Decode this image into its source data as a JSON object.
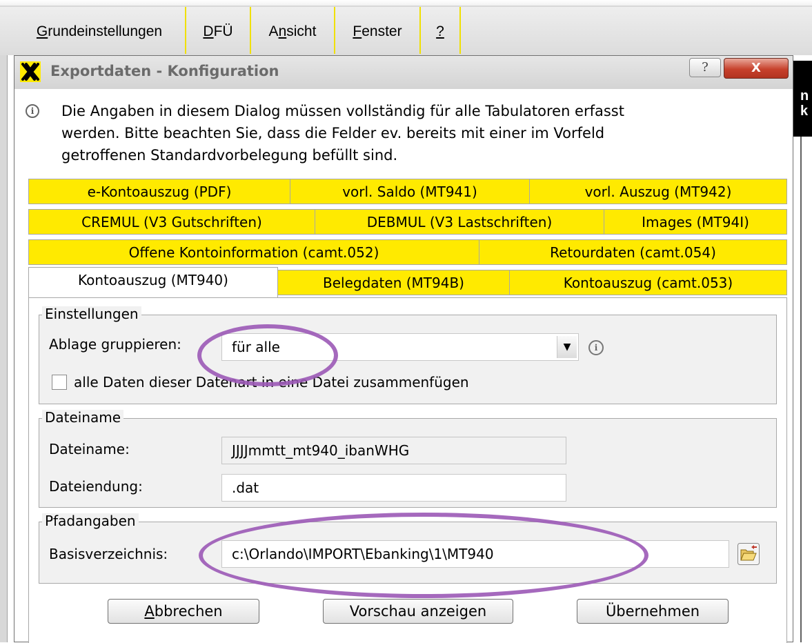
{
  "menu": {
    "items": [
      {
        "pre": "",
        "u": "G",
        "post": "rundeinstellungen"
      },
      {
        "pre": "",
        "u": "D",
        "post": "FÜ"
      },
      {
        "pre": "A",
        "u": "n",
        "post": "sicht"
      },
      {
        "pre": "",
        "u": "F",
        "post": "enster"
      },
      {
        "pre": "",
        "u": "?",
        "post": ""
      }
    ]
  },
  "app_strip": {
    "glyphs": [
      "n",
      "k"
    ]
  },
  "dialog": {
    "title": "Exportdaten - Konfiguration",
    "help_label": "?",
    "close_label": "X",
    "info_lines": [
      "Die Angaben in diesem Dialog müssen vollständig für alle Tabulatoren erfasst",
      "werden. Bitte beachten Sie, dass die Felder ev. bereits mit einer im Vorfeld",
      "getroffenen Standardvorbelegung befüllt sind."
    ],
    "tabs": {
      "row1": [
        "e-Kontoauszug (PDF)",
        "vorl. Saldo (MT941)",
        "vorl. Auszug (MT942)"
      ],
      "row2": [
        "CREMUL (V3 Gutschriften)",
        "DEBMUL (V3 Lastschriften)",
        "Images (MT94I)"
      ],
      "row3": [
        "Offene Kontoinformation (camt.052)",
        "Retourdaten (camt.054)"
      ],
      "row4": [
        "Kontoauszug (MT940)",
        "Belegdaten (MT94B)",
        "Kontoauszug (camt.053)"
      ],
      "active": "Kontoauszug (MT940)"
    },
    "einstellungen": {
      "legend": "Einstellungen",
      "ablage_label": "Ablage gruppieren:",
      "ablage_value": "für alle",
      "merge_label": "alle Daten dieser Datenart in eine Datei zusammenfügen",
      "merge_checked": false
    },
    "dateiname": {
      "legend": "Dateiname",
      "name_label": "Dateiname:",
      "name_value": "JJJJmmtt_mt940_ibanWHG",
      "ext_label": "Dateiendung:",
      "ext_value": ".dat"
    },
    "pfadangaben": {
      "legend": "Pfadangaben",
      "basis_label": "Basisverzeichnis:",
      "basis_value": "c:\\Orlando\\IMPORT\\Ebanking\\1\\MT940"
    },
    "buttons": {
      "cancel": {
        "pre": "",
        "u": "A",
        "post": "bbrechen"
      },
      "preview": "Vorschau anzeigen",
      "apply": "Übernehmen"
    }
  },
  "colors": {
    "tab_yellow": "#ffea00",
    "annotation": "#9b59b6",
    "menu_divider": "#f0e000"
  }
}
